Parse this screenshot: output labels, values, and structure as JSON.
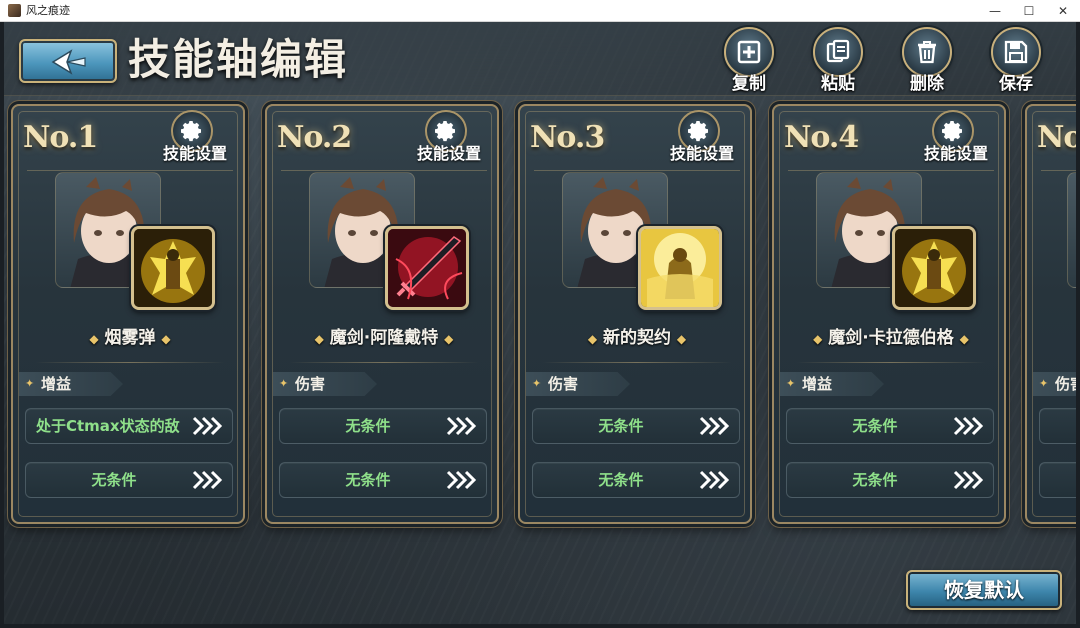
{
  "window": {
    "title": "风之痕迹",
    "minimize_glyph": "—",
    "maximize_glyph": "☐",
    "close_glyph": "✕"
  },
  "header": {
    "title": "技能轴编辑",
    "back_icon": "back-arrow-icon",
    "tools": [
      {
        "label": "复制",
        "icon": "copy-icon"
      },
      {
        "label": "粘贴",
        "icon": "paste-icon"
      },
      {
        "label": "删除",
        "icon": "trash-icon"
      },
      {
        "label": "保存",
        "icon": "save-icon"
      }
    ]
  },
  "cards": [
    {
      "number": "No.1",
      "setting_label": "技能设置",
      "skill_name": "烟雾弹",
      "type": "增益",
      "skill_color": "#e6c22a",
      "conditions": [
        "处于Ctmax状态的敌",
        "无条件"
      ]
    },
    {
      "number": "No.2",
      "setting_label": "技能设置",
      "skill_name": "魔剑·阿隆戴特",
      "type": "伤害",
      "skill_color": "#c8283a",
      "conditions": [
        "无条件",
        "无条件"
      ]
    },
    {
      "number": "No.3",
      "setting_label": "技能设置",
      "skill_name": "新的契约",
      "type": "伤害",
      "skill_color": "#f0d44a",
      "conditions": [
        "无条件",
        "无条件"
      ]
    },
    {
      "number": "No.4",
      "setting_label": "技能设置",
      "skill_name": "魔剑·卡拉德伯格",
      "type": "增益",
      "skill_color": "#e6c22a",
      "conditions": [
        "无条件",
        "无条件"
      ]
    },
    {
      "number": "No",
      "setting_label": "",
      "skill_name": "",
      "type": "伤害",
      "skill_color": "#e6c22a",
      "conditions": [
        "",
        ""
      ]
    }
  ],
  "footer": {
    "reset_label": "恢复默认"
  },
  "colors": {
    "condition_text": "#8fe08a",
    "accent_gold": "#c9b27a",
    "button_blue": "#3d85ab"
  }
}
